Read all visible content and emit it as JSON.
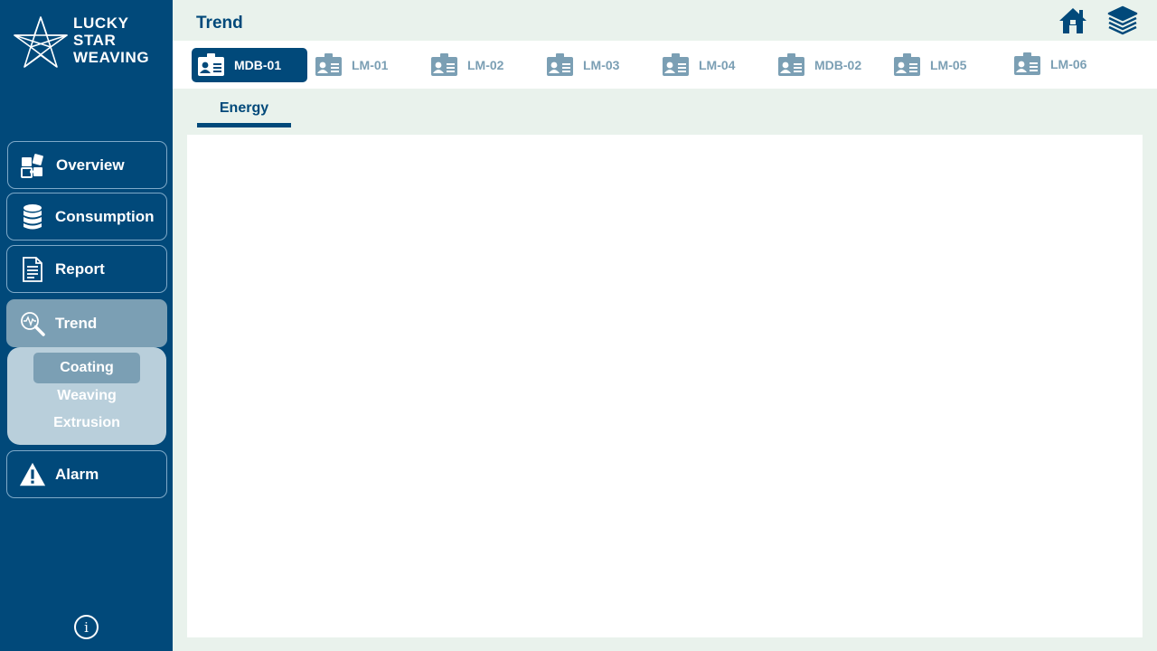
{
  "brand": {
    "line1": "LUCKY",
    "line2": "STAR",
    "line3": "WEAVING",
    "logo_icon": "star-icon"
  },
  "colors": {
    "sidebar": "#01497a",
    "accent": "#01497a",
    "muted": "#7b9fb4",
    "background": "#e9f2ec",
    "subpanel": "#b9cfdb"
  },
  "sidebar": {
    "items": [
      {
        "label": "Overview",
        "icon": "puzzle-icon"
      },
      {
        "label": "Consumption",
        "icon": "database-icon"
      },
      {
        "label": "Report",
        "icon": "document-icon"
      },
      {
        "label": "Trend",
        "icon": "magnifier-icon"
      },
      {
        "label": "Alarm",
        "icon": "warning-icon"
      }
    ],
    "active": "Trend",
    "submenu": [
      {
        "label": "Coating"
      },
      {
        "label": "Weaving"
      },
      {
        "label": "Extrusion"
      }
    ],
    "submenu_active": "Coating",
    "info_label": "i"
  },
  "header": {
    "title": "Trend",
    "icons": [
      "home-icon",
      "layers-icon"
    ]
  },
  "tabs": [
    {
      "label": "MDB-01"
    },
    {
      "label": "LM-01"
    },
    {
      "label": "LM-02"
    },
    {
      "label": "LM-03"
    },
    {
      "label": "LM-04"
    },
    {
      "label": "MDB-02"
    },
    {
      "label": "LM-05"
    },
    {
      "label": "LM-06"
    }
  ],
  "active_tab": "MDB-01",
  "subtabs": [
    {
      "label": "Energy"
    }
  ]
}
